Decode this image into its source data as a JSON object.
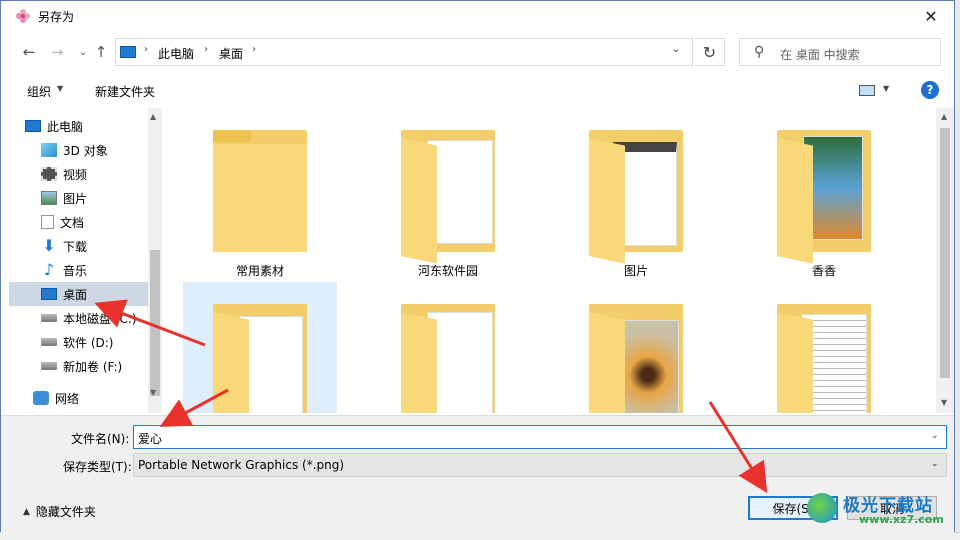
{
  "window": {
    "title": "另存为",
    "close_glyph": "✕"
  },
  "nav": {
    "back": "←",
    "forward": "→",
    "up": "↑"
  },
  "address": {
    "crumbs": [
      "此电脑",
      "桌面"
    ],
    "sep": "›",
    "dropdown": "⌄",
    "refresh": "↻"
  },
  "search": {
    "placeholder": "在 桌面 中搜索",
    "icon": "⚲"
  },
  "toolbar": {
    "organize": "组织",
    "new_folder": "新建文件夹",
    "help": "?",
    "caret": "▼"
  },
  "sidebar": {
    "items": [
      {
        "label": "此电脑",
        "icon": "computer-icon"
      },
      {
        "label": "3D 对象",
        "icon": "cube-icon"
      },
      {
        "label": "视频",
        "icon": "video-icon"
      },
      {
        "label": "图片",
        "icon": "picture-icon"
      },
      {
        "label": "文档",
        "icon": "document-icon"
      },
      {
        "label": "下载",
        "icon": "download-icon"
      },
      {
        "label": "音乐",
        "icon": "music-icon"
      },
      {
        "label": "桌面",
        "icon": "desktop-icon",
        "selected": true
      },
      {
        "label": "本地磁盘 (C:)",
        "icon": "drive-icon"
      },
      {
        "label": "软件 (D:)",
        "icon": "drive-icon"
      },
      {
        "label": "新加卷 (F:)",
        "icon": "drive-icon"
      },
      {
        "label": "网络",
        "icon": "network-icon"
      }
    ],
    "scroll_up": "▲",
    "scroll_down": "▼"
  },
  "folders": [
    {
      "label": "常用素材"
    },
    {
      "label": "河东软件园"
    },
    {
      "label": "图片"
    },
    {
      "label": "香香"
    },
    {
      "label": ""
    },
    {
      "label": ""
    },
    {
      "label": ""
    },
    {
      "label": ""
    }
  ],
  "form": {
    "filename_label": "文件名(N):",
    "filename_value": "爱心",
    "filetype_label": "保存类型(T):",
    "filetype_value": "Portable Network Graphics (*.png)",
    "hide_folders": "隐藏文件夹",
    "save": "保存(S)",
    "cancel": "取消"
  },
  "watermark": {
    "line1": "极光下载站",
    "line2": "www.xz7.com"
  },
  "colors": {
    "accent": "#1f78d1",
    "folder": "#f3cd6a",
    "selection": "#ccd8e4",
    "arrow": "#e8322b"
  }
}
